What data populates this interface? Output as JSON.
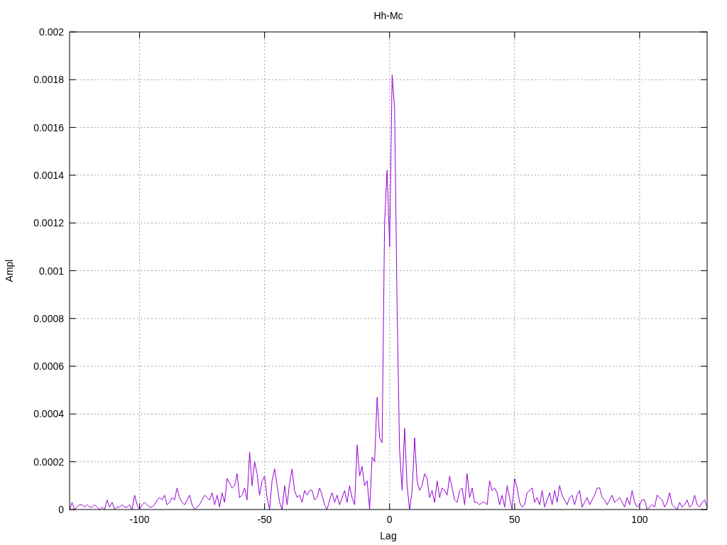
{
  "chart_data": {
    "type": "line",
    "grid": true,
    "title": "Hh-Mc",
    "xlabel": "Lag",
    "ylabel": "Ampl",
    "xlim": [
      -128,
      127
    ],
    "ylim": [
      0,
      0.002
    ],
    "xticks": [
      {
        "value": -100,
        "label": "-100"
      },
      {
        "value": -50,
        "label": "-50"
      },
      {
        "value": 0,
        "label": "0"
      },
      {
        "value": 50,
        "label": "50"
      },
      {
        "value": 100,
        "label": "100"
      }
    ],
    "yticks": [
      {
        "value": 0,
        "label": "0"
      },
      {
        "value": 0.0002,
        "label": "0.0002"
      },
      {
        "value": 0.0004,
        "label": "0.0004"
      },
      {
        "value": 0.0006,
        "label": "0.0006"
      },
      {
        "value": 0.0008,
        "label": "0.0008"
      },
      {
        "value": 0.001,
        "label": "0.001"
      },
      {
        "value": 0.0012,
        "label": "0.0012"
      },
      {
        "value": 0.0014,
        "label": "0.0014"
      },
      {
        "value": 0.0016,
        "label": "0.0016"
      },
      {
        "value": 0.0018,
        "label": "0.0018"
      },
      {
        "value": 0.002,
        "label": "0.002"
      }
    ],
    "x": [
      -128,
      -127,
      -126,
      -125,
      -124,
      -123,
      -122,
      -121,
      -120,
      -119,
      -118,
      -117,
      -116,
      -115,
      -114,
      -113,
      -112,
      -111,
      -110,
      -109,
      -108,
      -107,
      -106,
      -105,
      -104,
      -103,
      -102,
      -101,
      -100,
      -99,
      -98,
      -97,
      -96,
      -95,
      -94,
      -93,
      -92,
      -91,
      -90,
      -89,
      -88,
      -87,
      -86,
      -85,
      -84,
      -83,
      -82,
      -81,
      -80,
      -79,
      -78,
      -77,
      -76,
      -75,
      -74,
      -73,
      -72,
      -71,
      -70,
      -69,
      -68,
      -67,
      -66,
      -65,
      -64,
      -63,
      -62,
      -61,
      -60,
      -59,
      -58,
      -57,
      -56,
      -55,
      -54,
      -53,
      -52,
      -51,
      -50,
      -49,
      -48,
      -47,
      -46,
      -45,
      -44,
      -43,
      -42,
      -41,
      -40,
      -39,
      -38,
      -37,
      -36,
      -35,
      -34,
      -33,
      -32,
      -31,
      -30,
      -29,
      -28,
      -27,
      -26,
      -25,
      -24,
      -23,
      -22,
      -21,
      -20,
      -19,
      -18,
      -17,
      -16,
      -15,
      -14,
      -13,
      -12,
      -11,
      -10,
      -9,
      -8,
      -7,
      -6,
      -5,
      -4,
      -3,
      -2,
      -1,
      0,
      1,
      2,
      3,
      4,
      5,
      6,
      7,
      8,
      9,
      10,
      11,
      12,
      13,
      14,
      15,
      16,
      17,
      18,
      19,
      20,
      21,
      22,
      23,
      24,
      25,
      26,
      27,
      28,
      29,
      30,
      31,
      32,
      33,
      34,
      35,
      36,
      37,
      38,
      39,
      40,
      41,
      42,
      43,
      44,
      45,
      46,
      47,
      48,
      49,
      50,
      51,
      52,
      53,
      54,
      55,
      56,
      57,
      58,
      59,
      60,
      61,
      62,
      63,
      64,
      65,
      66,
      67,
      68,
      69,
      70,
      71,
      72,
      73,
      74,
      75,
      76,
      77,
      78,
      79,
      80,
      81,
      82,
      83,
      84,
      85,
      86,
      87,
      88,
      89,
      90,
      91,
      92,
      93,
      94,
      95,
      96,
      97,
      98,
      99,
      100,
      101,
      102,
      103,
      104,
      105,
      106,
      107,
      108,
      109,
      110,
      111,
      112,
      113,
      114,
      115,
      116,
      117,
      118,
      119,
      120,
      121,
      122,
      123,
      124,
      125,
      126,
      127
    ],
    "series": [
      {
        "color": "#9400d3",
        "values": [
          0,
          3e-05,
          0,
          1e-05,
          2e-05,
          2e-05,
          1e-05,
          2e-05,
          1e-05,
          1e-05,
          2e-05,
          1e-05,
          0,
          1e-05,
          0,
          4e-05,
          1e-05,
          3e-05,
          0,
          1e-05,
          1e-05,
          2e-05,
          1e-05,
          1e-05,
          2e-05,
          0,
          6e-05,
          2e-05,
          0,
          2e-05,
          3e-05,
          2e-05,
          1e-05,
          1e-05,
          2e-05,
          4e-05,
          5e-05,
          4e-05,
          6e-05,
          2e-05,
          3e-05,
          5e-05,
          4e-05,
          9e-05,
          5e-05,
          3e-05,
          2e-05,
          4e-05,
          6e-05,
          2e-05,
          0,
          1e-05,
          2e-05,
          4e-05,
          6e-05,
          5e-05,
          4e-05,
          7e-05,
          2e-05,
          6e-05,
          1e-05,
          7e-05,
          3e-05,
          0.00013,
          0.00011,
          9e-05,
          0.0001,
          0.00015,
          5e-05,
          6e-05,
          9e-05,
          4e-05,
          0.00024,
          0.0001,
          0.0002,
          0.00015,
          6e-05,
          0.00012,
          0.00014,
          5e-05,
          0,
          0.00012,
          0.00017,
          0.0001,
          3e-05,
          0,
          0.0001,
          2e-05,
          0.00011,
          0.00017,
          8e-05,
          5e-05,
          6e-05,
          3e-05,
          8e-05,
          6e-05,
          8e-05,
          8e-05,
          4e-05,
          5e-05,
          9e-05,
          6e-05,
          2e-05,
          0,
          4e-05,
          7e-05,
          3e-05,
          6e-05,
          2e-05,
          5e-05,
          8e-05,
          3e-05,
          0.0001,
          5e-05,
          2e-05,
          0.00027,
          0.00014,
          0.00018,
          0.0001,
          0.00012,
          0,
          0.00022,
          0.0002,
          0.00047,
          0.0003,
          0.00028,
          0.0012,
          0.00142,
          0.0011,
          0.00182,
          0.00168,
          0.00085,
          0.00025,
          8e-05,
          0.00034,
          0.0001,
          0,
          8e-05,
          0.0003,
          0.00012,
          8e-05,
          0.0001,
          0.00015,
          0.00013,
          5e-05,
          8e-05,
          3e-05,
          0.00012,
          5e-05,
          9e-05,
          8e-05,
          6e-05,
          0.00014,
          9e-05,
          4e-05,
          3e-05,
          8e-05,
          9e-05,
          2e-05,
          0.00015,
          5e-05,
          9e-05,
          3e-05,
          3e-05,
          2e-05,
          3e-05,
          3e-05,
          2e-05,
          0.00012,
          8e-05,
          9e-05,
          7e-05,
          2e-05,
          6e-05,
          1e-05,
          0.0001,
          5e-05,
          0,
          0.00013,
          9e-05,
          3e-05,
          1e-05,
          2e-05,
          7e-05,
          8e-05,
          9e-05,
          3e-05,
          5e-05,
          2e-05,
          8e-05,
          1e-05,
          4e-05,
          7e-05,
          2e-05,
          8e-05,
          3e-05,
          0.0001,
          6e-05,
          4e-05,
          2e-05,
          5e-05,
          6e-05,
          2e-05,
          6e-05,
          8e-05,
          1e-05,
          3e-05,
          5e-05,
          2e-05,
          4e-05,
          6e-05,
          9e-05,
          9e-05,
          5e-05,
          4e-05,
          2e-05,
          4e-05,
          6e-05,
          3e-05,
          4e-05,
          5e-05,
          3e-05,
          1e-05,
          5e-05,
          2e-05,
          8e-05,
          3e-05,
          1e-05,
          2e-05,
          4e-05,
          4e-05,
          0,
          1e-05,
          2e-05,
          1e-05,
          6e-05,
          5e-05,
          4e-05,
          1e-05,
          3e-05,
          7e-05,
          2e-05,
          1e-05,
          0,
          3e-05,
          1e-05,
          2e-05,
          4e-05,
          1e-05,
          2e-05,
          6e-05,
          2e-05,
          1e-05,
          3e-05,
          4e-05,
          1e-05
        ]
      }
    ]
  }
}
